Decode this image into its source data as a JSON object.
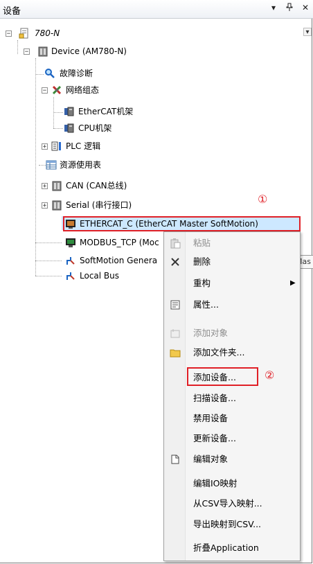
{
  "panel": {
    "title": "设备",
    "pin_glyph": "▾",
    "dock_glyph": "ᵠ",
    "close_glyph": "✕"
  },
  "tree": {
    "root": "780-N",
    "device": "Device (AM780-N)",
    "diag": "故障诊断",
    "network": "网络组态",
    "ethercat_rack": "EtherCAT机架",
    "cpu_rack": "CPU机架",
    "plc": "PLC 逻辑",
    "resource": "资源使用表",
    "can": "CAN (CAN总线)",
    "serial": "Serial (串行接口)",
    "ethercat": "ETHERCAT_C (EtherCAT Master SoftMotion)",
    "modbus": "MODBUS_TCP (Moc",
    "softmotion": "SoftMotion Genera",
    "localbus": "Local Bus"
  },
  "tooltip": "Mas",
  "annotations": {
    "one": "①",
    "two": "②"
  },
  "menu": {
    "paste": "粘贴",
    "delete": "删除",
    "refactor": "重构",
    "properties": "属性...",
    "add_object": "添加对象",
    "add_folder": "添加文件夹...",
    "add_device": "添加设备...",
    "scan_device": "扫描设备...",
    "disable_device": "禁用设备",
    "update_device": "更新设备...",
    "edit_object": "编辑对象",
    "edit_io": "编辑IO映射",
    "import_csv": "从CSV导入映射...",
    "export_csv": "导出映射到CSV...",
    "collapse": "折叠Application"
  },
  "colors": {
    "accent_red": "#e01f26",
    "selection": "#cde8ff"
  }
}
